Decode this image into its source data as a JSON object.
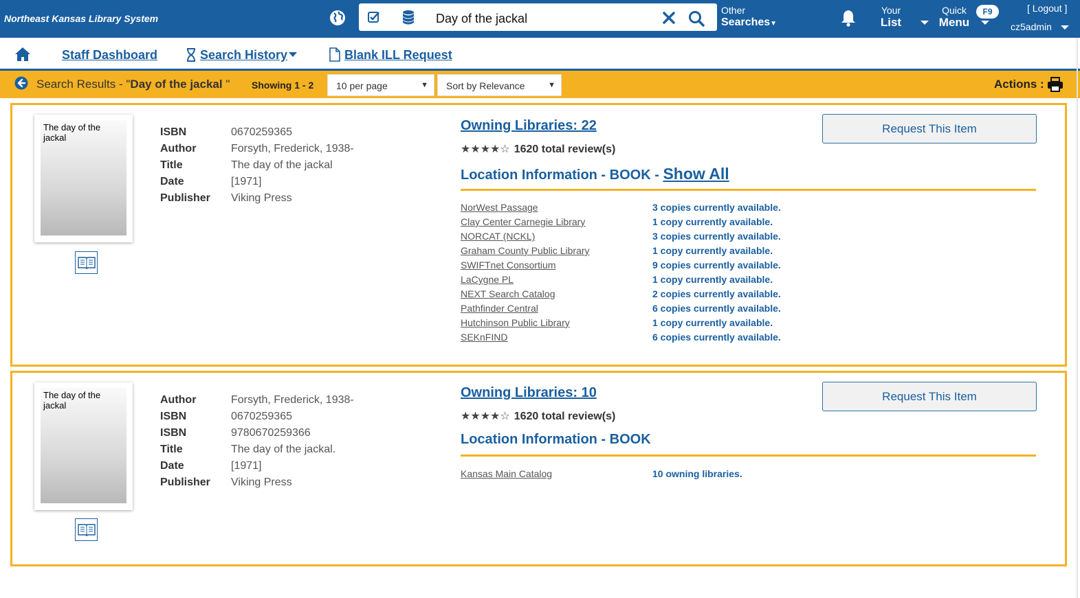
{
  "topbar": {
    "brand": "Northeast Kansas Library System",
    "search_value": "Day of the jackal",
    "other_searches_l1": "Other",
    "other_searches_l2": "Searches",
    "your_list_l1": "Your",
    "your_list_l2": "List",
    "quick_menu_l1": "Quick",
    "quick_menu_l2": "Menu",
    "quick_menu_hotkey": "F9",
    "logout": "[ Logout ]",
    "username": "cz5admin"
  },
  "nav": {
    "staff_dashboard": "Staff Dashboard",
    "search_history": "Search History",
    "blank_ill": "Blank ILL Request"
  },
  "results_bar": {
    "prefix": "Search Results - \"",
    "query": "Day of the jackal",
    "suffix": " \"",
    "showing": "Showing 1 - 2",
    "per_page": "10 per page",
    "sort": "Sort by Relevance",
    "actions": "Actions :"
  },
  "results": [
    {
      "cover_title": "The day of the jackal",
      "meta": [
        {
          "label": "ISBN",
          "value": "0670259365"
        },
        {
          "label": "Author",
          "value": "Forsyth, Frederick, 1938-"
        },
        {
          "label": "Title",
          "value": "The day of the jackal"
        },
        {
          "label": "Date",
          "value": "[1971]"
        },
        {
          "label": "Publisher",
          "value": "Viking Press"
        }
      ],
      "owning": "Owning Libraries: 22",
      "stars": "★★★★☆",
      "reviews": "1620 total review(s)",
      "loc_title": "Location Information - BOOK - ",
      "show_all": "Show All",
      "locations": [
        {
          "name": "NorWest Passage",
          "avail": "3 copies currently available."
        },
        {
          "name": "Clay Center Carnegie Library",
          "avail": "1 copy currently available."
        },
        {
          "name": "NORCAT (NCKL)",
          "avail": "3 copies currently available."
        },
        {
          "name": "Graham County Public Library",
          "avail": "1 copy currently available."
        },
        {
          "name": "SWIFTnet Consortium",
          "avail": "9 copies currently available."
        },
        {
          "name": "LaCygne PL",
          "avail": "1 copy currently available."
        },
        {
          "name": "NEXT Search Catalog",
          "avail": "2 copies currently available."
        },
        {
          "name": "Pathfinder Central",
          "avail": "6 copies currently available."
        },
        {
          "name": "Hutchinson Public Library",
          "avail": "1 copy currently available."
        },
        {
          "name": "SEKnFIND",
          "avail": "6 copies currently available."
        }
      ],
      "request": "Request This Item"
    },
    {
      "cover_title": "The day of the jackal",
      "meta": [
        {
          "label": "Author",
          "value": "Forsyth, Frederick, 1938-"
        },
        {
          "label": "ISBN",
          "value": "0670259365"
        },
        {
          "label": "ISBN",
          "value": "9780670259366"
        },
        {
          "label": "Title",
          "value": "The day of the jackal."
        },
        {
          "label": "Date",
          "value": "[1971]"
        },
        {
          "label": "Publisher",
          "value": "Viking Press"
        }
      ],
      "owning": "Owning Libraries: 10",
      "stars": "★★★★☆",
      "reviews": "1620 total review(s)",
      "loc_title": "Location Information - BOOK",
      "locations": [
        {
          "name": "Kansas Main Catalog",
          "avail": "10 owning libraries."
        }
      ],
      "request": "Request This Item"
    }
  ]
}
